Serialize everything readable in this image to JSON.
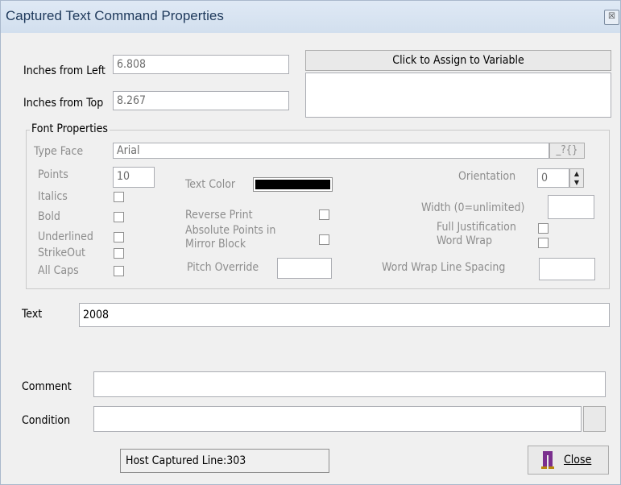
{
  "window": {
    "title": "Captured Text Command Properties",
    "close_glyph": "☒"
  },
  "position": {
    "left_label": "Inches from Left",
    "left_value": "6.808",
    "top_label": "Inches from Top",
    "top_value": "8.267"
  },
  "assign": {
    "button_label": "Click to Assign to Variable",
    "variable_value": ""
  },
  "font": {
    "group_title": "Font Properties",
    "type_face_label": "Type Face",
    "type_face_value": "Arial",
    "type_face_button": "_?{}",
    "points_label": "Points",
    "points_value": "10",
    "text_color_label": "Text Color",
    "text_color": "#000000",
    "orientation_label": "Orientation",
    "orientation_value": "0",
    "width_label": "Width (0=unlimited)",
    "width_value": "",
    "italics_label": "Italics",
    "bold_label": "Bold",
    "underlined_label": "Underlined",
    "strikeout_label": "StrikeOut",
    "allcaps_label": "All Caps",
    "reverse_print_label": "Reverse Print",
    "absolute_points_label_1": "Absolute Points in",
    "absolute_points_label_2": "Mirror Block",
    "pitch_override_label": "Pitch Override",
    "pitch_override_value": "",
    "full_justification_label": "Full Justification",
    "word_wrap_label": "Word Wrap",
    "word_wrap_spacing_label": "Word Wrap Line Spacing",
    "word_wrap_spacing_value": ""
  },
  "text": {
    "label": "Text",
    "value": "2008"
  },
  "comment": {
    "label": "Comment",
    "value": ""
  },
  "condition": {
    "label": "Condition",
    "value": ""
  },
  "status": {
    "text": "Host Captured  Line:303"
  },
  "close_button": {
    "label": "Close",
    "icon": "pants-icon"
  }
}
